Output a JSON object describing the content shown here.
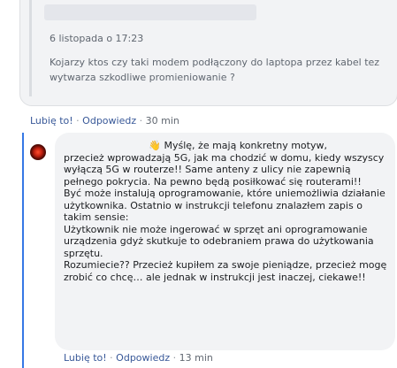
{
  "quote": {
    "date": "6 listopada o 17:23",
    "text": "Kojarzy ktos czy taki modem podłączony do laptopa przez kabel tez wytwarza szkodliwe promieniowanie ?"
  },
  "actions1": {
    "like": "Lubię to!",
    "reply": "Odpowiedz",
    "sep": "·",
    "time": "30 min"
  },
  "comment": {
    "emoji": "👋",
    "text_first": " Myślę, że mają konkretny motyw,",
    "text_rest": "przecież wprowadzają 5G, jak ma chodzić w domu, kiedy wszyscy wyłączą 5G w routerze!! Same anteny z ulicy nie zapewnią pełnego pokrycia. Na pewno będą posiłkować się routerami!!\nByć może instalują oprogramowanie, które uniemożliwia działanie użytkownika. Ostatnio w instrukcji telefonu znalazłem zapis o takim sensie:\nUżytkownik nie może ingerować w sprzęt ani oprogramowanie urządzenia gdyż skutkuje to odebraniem prawa do użytkowania sprzętu.\nRozumiecie?? Przecież kupiłem za swoje pieniądze, przecież mogę zrobić co chcę… ale jednak w instrukcji jest inaczej, ciekawe!!"
  },
  "actions2": {
    "like": "Lubię to!",
    "reply": "Odpowiedz",
    "sep": "·",
    "time": "13 min"
  }
}
